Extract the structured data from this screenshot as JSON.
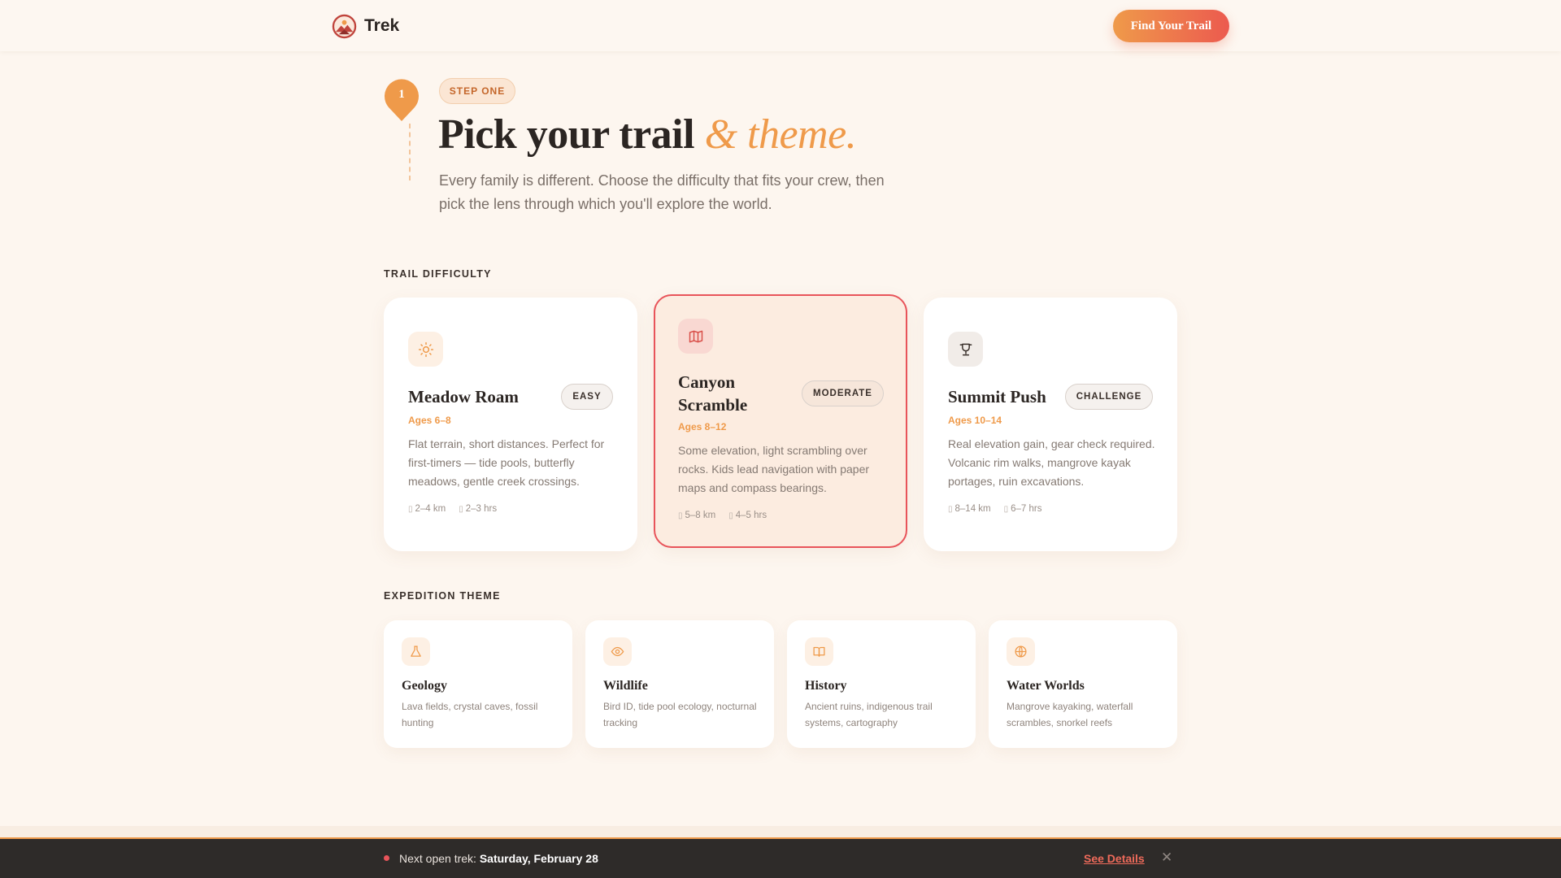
{
  "header": {
    "brand": "Trek",
    "cta_label": "Find Your Trail"
  },
  "hero": {
    "step_number": "1",
    "step_badge": "STEP ONE",
    "title_main": "Pick your trail",
    "title_accent": "& theme.",
    "subtitle": "Every family is different. Choose the difficulty that fits your crew, then pick the lens through which you'll explore the world."
  },
  "difficulty": {
    "label": "TRAIL DIFFICULTY",
    "selected": "Canyon Scramble",
    "cards": [
      {
        "icon": "sun-icon",
        "title": "Meadow Roam",
        "level": "EASY",
        "ages": "Ages 6–8",
        "description": "Flat terrain, short distances. Perfect for first-timers — tide pools, butterfly meadows, gentle creek crossings.",
        "distance": "2–4 km",
        "duration": "2–3 hrs"
      },
      {
        "icon": "map-icon",
        "title": "Canyon Scramble",
        "level": "MODERATE",
        "ages": "Ages 8–12",
        "description": "Some elevation, light scrambling over rocks. Kids lead navigation with paper maps and compass bearings.",
        "distance": "5–8 km",
        "duration": "4–5 hrs"
      },
      {
        "icon": "trophy-icon",
        "title": "Summit Push",
        "level": "CHALLENGE",
        "ages": "Ages 10–14",
        "description": "Real elevation gain, gear check required. Volcanic rim walks, mangrove kayak portages, ruin excavations.",
        "distance": "8–14 km",
        "duration": "6–7 hrs"
      }
    ],
    "meta_icon": "▯"
  },
  "themes": {
    "label": "EXPEDITION THEME",
    "cards": [
      {
        "icon": "flask-icon",
        "title": "Geology",
        "description": "Lava fields, crystal caves, fossil hunting"
      },
      {
        "icon": "eye-icon",
        "title": "Wildlife",
        "description": "Bird ID, tide pool ecology, nocturnal tracking"
      },
      {
        "icon": "book-icon",
        "title": "History",
        "description": "Ancient ruins, indigenous trail systems, cartography"
      },
      {
        "icon": "globe-icon",
        "title": "Water Worlds",
        "description": "Mangrove kayaking, waterfall scrambles, snorkel reefs"
      }
    ]
  },
  "notice": {
    "prefix": "Next open trek:",
    "date": "Saturday, February 28",
    "link": "See Details",
    "close": "✕"
  },
  "colors": {
    "accent_orange": "#ef9a4a",
    "accent_red": "#e8545a",
    "background": "#fdf6ef",
    "notice_bar": "#2e2b29"
  }
}
